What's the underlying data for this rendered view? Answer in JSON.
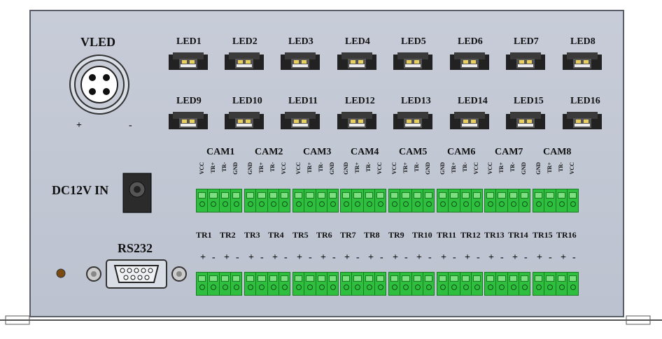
{
  "labels": {
    "vled": "VLED",
    "plus": "+",
    "minus": "-",
    "dc": "DC12V IN",
    "rs232": "RS232"
  },
  "leds_row1": [
    "LED1",
    "LED2",
    "LED3",
    "LED4",
    "LED5",
    "LED6",
    "LED7",
    "LED8"
  ],
  "leds_row2": [
    "LED9",
    "LED10",
    "LED11",
    "LED12",
    "LED13",
    "LED14",
    "LED15",
    "LED16"
  ],
  "cams": [
    "CAM1",
    "CAM2",
    "CAM3",
    "CAM4",
    "CAM5",
    "CAM6",
    "CAM7",
    "CAM8"
  ],
  "cam_pins": [
    [
      "VCC",
      "TR+",
      "TR-",
      "GND"
    ],
    [
      "GND",
      "TR+",
      "TR-",
      "VCC"
    ],
    [
      "VCC",
      "TR+",
      "TR-",
      "GND"
    ],
    [
      "GND",
      "TR+",
      "TR-",
      "VCC"
    ],
    [
      "VCC",
      "TR+",
      "TR-",
      "GND"
    ],
    [
      "GND",
      "TR+",
      "TR-",
      "VCC"
    ],
    [
      "VCC",
      "TR+",
      "TR-",
      "GND"
    ],
    [
      "GND",
      "TR+",
      "TR-",
      "VCC"
    ]
  ],
  "triggers": [
    "TR1",
    "TR2",
    "TR3",
    "TR4",
    "TR5",
    "TR6",
    "TR7",
    "TR8",
    "TR9",
    "TR10",
    "TR11",
    "TR12",
    "TR13",
    "TR14",
    "TR15",
    "TR16"
  ],
  "trigger_signs": [
    "+",
    "-"
  ],
  "colors": {
    "panel": "#c3c8d4",
    "terminal": "#2fbf3f"
  }
}
